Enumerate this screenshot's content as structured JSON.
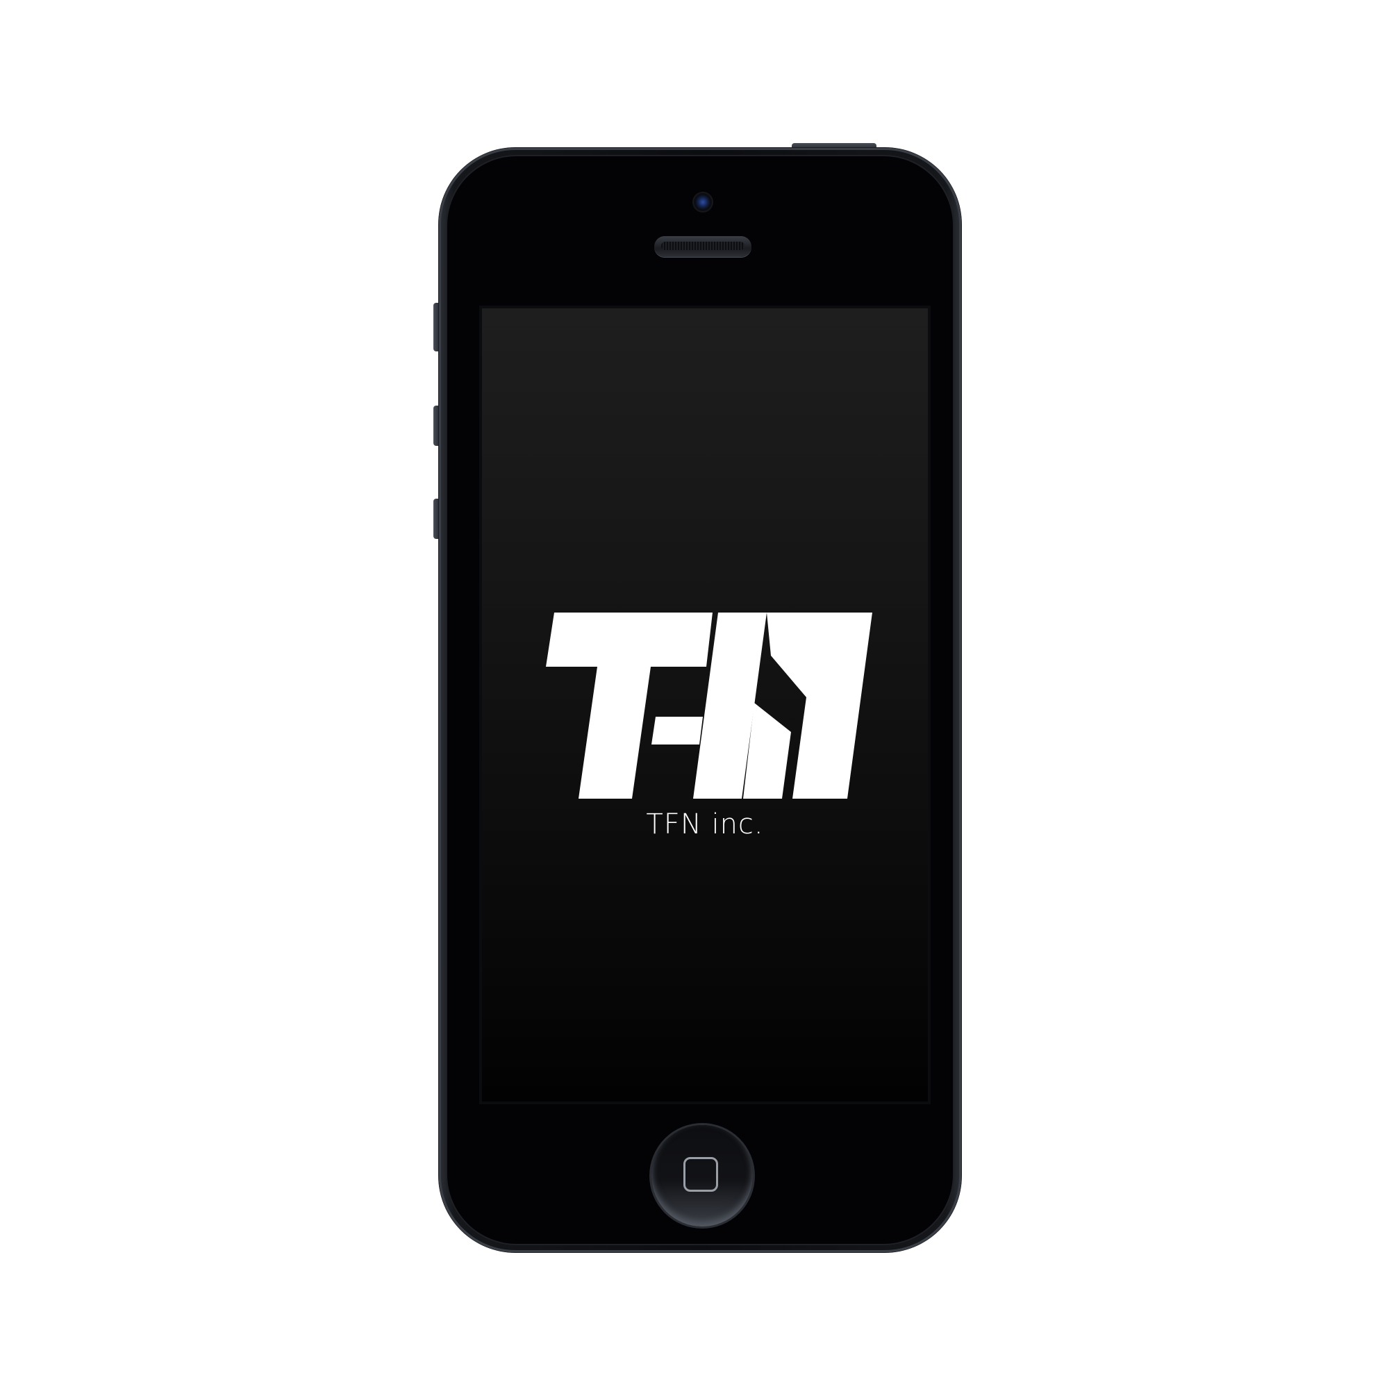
{
  "device": {
    "type": "smartphone",
    "body_color": "#0c0d10",
    "screen_background": "#141414"
  },
  "splash": {
    "logo_text": "TFN",
    "company_name": "TFN inc.",
    "text_color": "#ffffff"
  },
  "icons": {
    "camera": "front-camera-icon",
    "speaker": "earpiece-speaker-icon",
    "home": "home-button-icon"
  }
}
